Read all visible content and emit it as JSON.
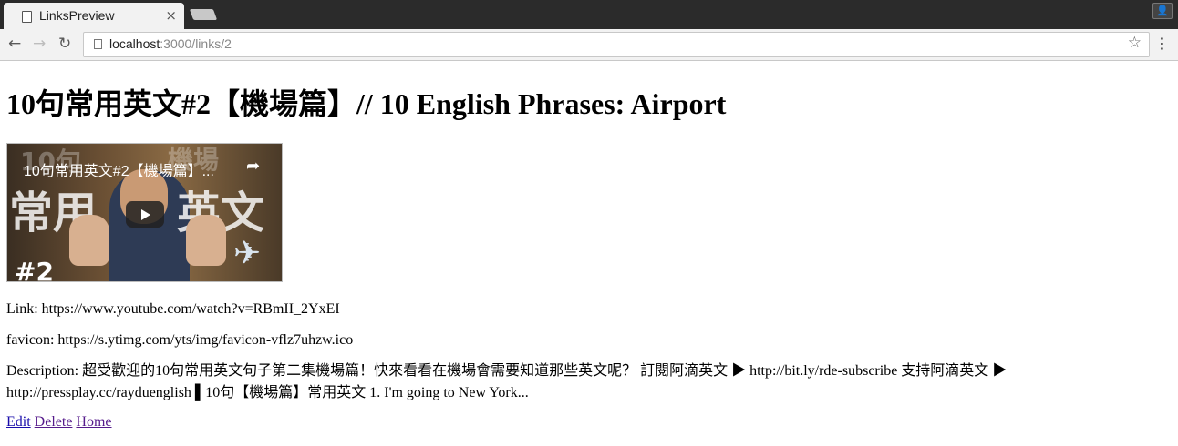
{
  "browser": {
    "tab_title": "LinksPreview",
    "tab_close": "×",
    "url_host": "localhost",
    "url_path": ":3000/links/2",
    "back_icon": "←",
    "forward_icon": "→",
    "reload_icon": "↻",
    "star_icon": "☆",
    "menu_icon": "⋮",
    "profile_icon": "👤"
  },
  "page": {
    "title": "10句常用英文#2【機場篇】// 10 English Phrases: Airport",
    "video": {
      "overlay_title": "10句常用英文#2【機場篇】...",
      "share_icon": "➦",
      "bg_text_1": "10句",
      "bg_text_2": "常用",
      "bg_text_3": "英文",
      "bg_text_4": "機場",
      "number": "#2",
      "plane_icon": "✈"
    },
    "link_line": "Link: https://www.youtube.com/watch?v=RBmII_2YxEI",
    "favicon_line": "favicon: https://s.ytimg.com/yts/img/favicon-vflz7uhzw.ico",
    "description_line": "Description: 超受歡迎的10句常用英文句子第二集機場篇！快來看看在機場會需要知道那些英文呢？ 訂閱阿滴英文 ▶ http://bit.ly/rde-subscribe 支持阿滴英文 ▶ http://pressplay.cc/rayduenglish ▌10句【機場篇】常用英文 1. I'm going to New York...",
    "actions": {
      "edit": "Edit",
      "delete": "Delete",
      "home": "Home"
    }
  }
}
